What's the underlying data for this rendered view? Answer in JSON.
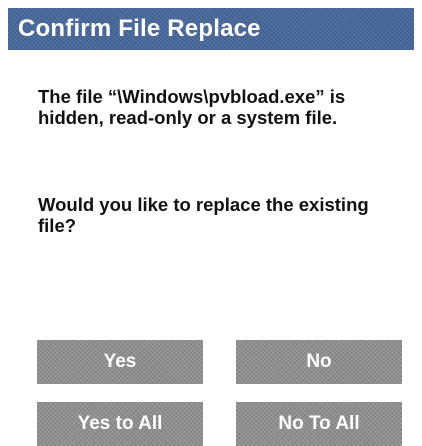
{
  "dialog": {
    "title": "Confirm File Replace",
    "message_line_1": "The file “\\Windows\\pvbload.exe” is hidden, read-only or a system file.",
    "message_line_2": "Would you like to replace the existing file?"
  },
  "buttons": {
    "yes": "Yes",
    "no": "No",
    "yes_to_all": "Yes to All",
    "no_to_all": "No To All"
  },
  "colors": {
    "title_bar": "#46679a",
    "button": "#8f8f8f",
    "text": "#111111"
  }
}
